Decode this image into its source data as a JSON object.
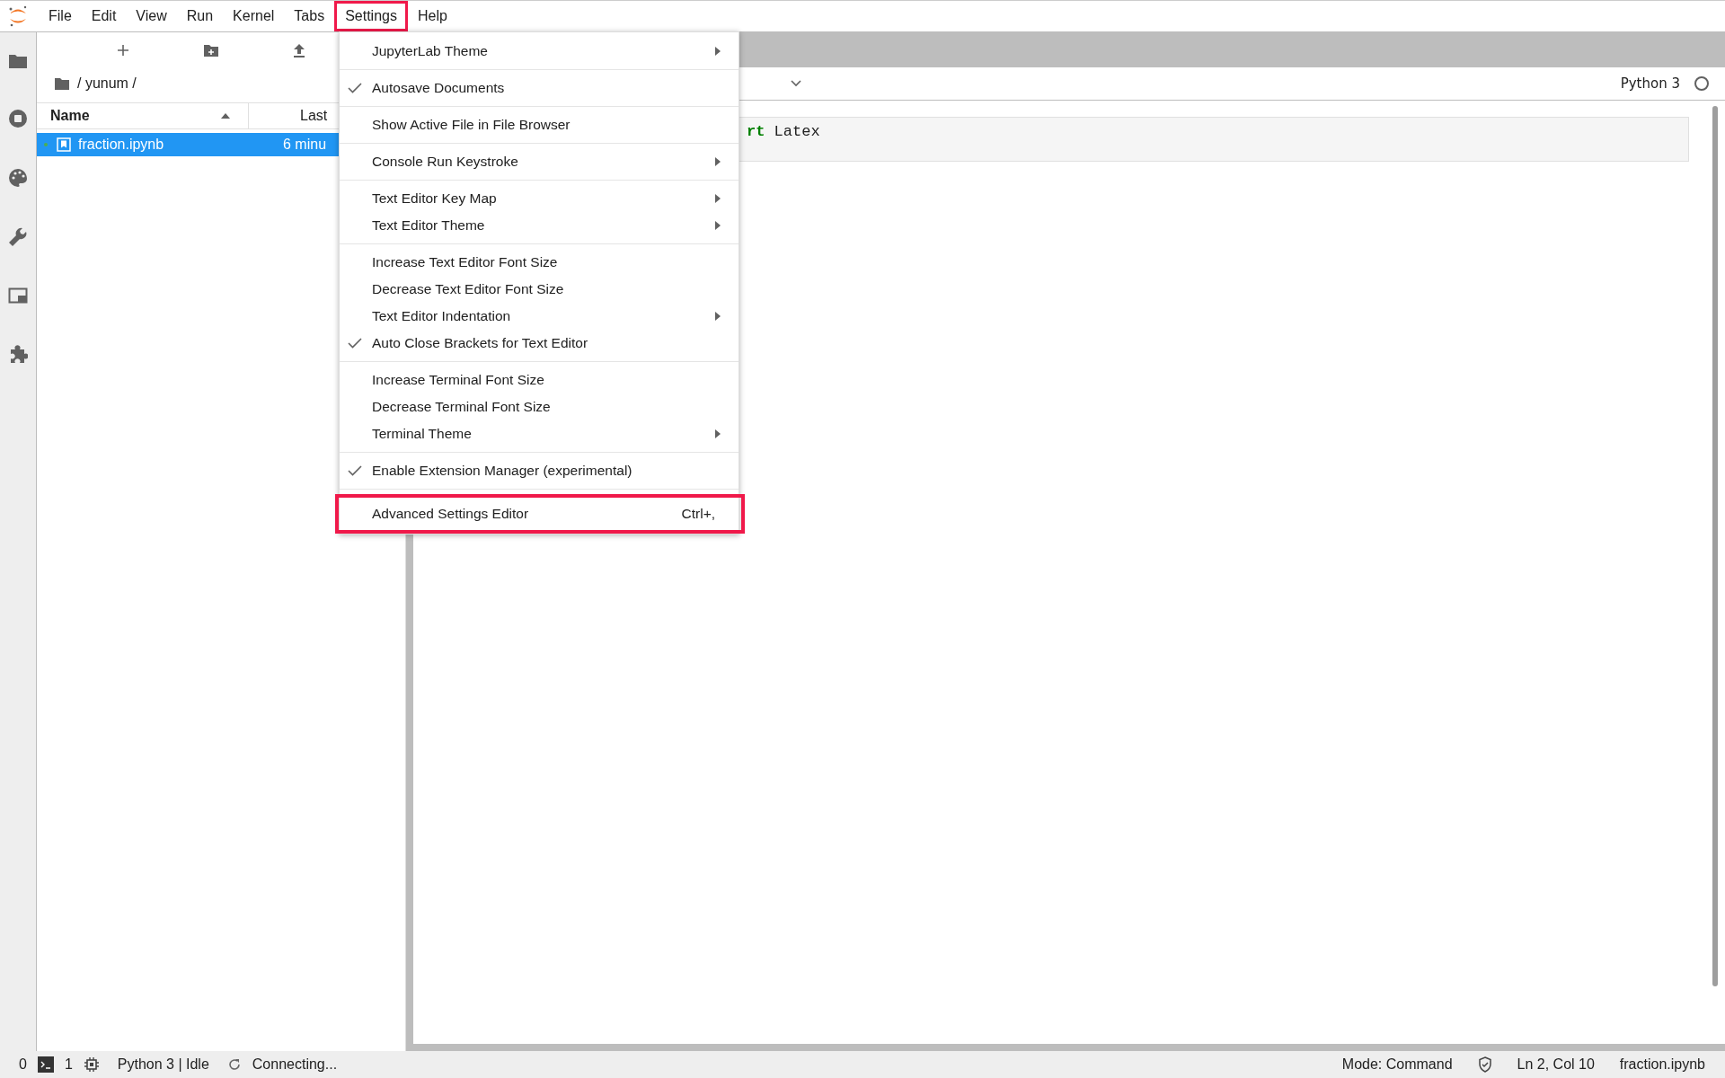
{
  "menu_bar": [
    {
      "label": "File",
      "selected": false
    },
    {
      "label": "Edit",
      "selected": false
    },
    {
      "label": "View",
      "selected": false
    },
    {
      "label": "Run",
      "selected": false
    },
    {
      "label": "Kernel",
      "selected": false
    },
    {
      "label": "Tabs",
      "selected": false
    },
    {
      "label": "Settings",
      "selected": true
    },
    {
      "label": "Help",
      "selected": false
    }
  ],
  "file_browser": {
    "breadcrumb": "/ yunum /",
    "columns": [
      "Name",
      "Last"
    ],
    "rows": [
      {
        "name": "fraction.ipynb",
        "modified": "6 minu",
        "selected": true,
        "running": true
      }
    ]
  },
  "notebook": {
    "kernel": "Python 3",
    "kernel_busy": false,
    "cell_code": [
      {
        "text": "rt",
        "kind": "keyword"
      },
      {
        "text": " Latex",
        "kind": "plain"
      }
    ]
  },
  "settings_menu": {
    "groups": [
      [
        {
          "label": "JupyterLab Theme",
          "checked": false,
          "submenu": true,
          "highlighted": false
        }
      ],
      [
        {
          "label": "Autosave Documents",
          "checked": true,
          "submenu": false,
          "highlighted": false
        }
      ],
      [
        {
          "label": "Show Active File in File Browser",
          "checked": false,
          "submenu": false,
          "highlighted": false
        }
      ],
      [
        {
          "label": "Console Run Keystroke",
          "checked": false,
          "submenu": true,
          "highlighted": false
        }
      ],
      [
        {
          "label": "Text Editor Key Map",
          "checked": false,
          "submenu": true,
          "highlighted": false
        },
        {
          "label": "Text Editor Theme",
          "checked": false,
          "submenu": true,
          "highlighted": false
        }
      ],
      [
        {
          "label": "Increase Text Editor Font Size",
          "checked": false,
          "submenu": false,
          "highlighted": false
        },
        {
          "label": "Decrease Text Editor Font Size",
          "checked": false,
          "submenu": false,
          "highlighted": false
        },
        {
          "label": "Text Editor Indentation",
          "checked": false,
          "submenu": true,
          "highlighted": false
        },
        {
          "label": "Auto Close Brackets for Text Editor",
          "checked": true,
          "submenu": false,
          "highlighted": false
        }
      ],
      [
        {
          "label": "Increase Terminal Font Size",
          "checked": false,
          "submenu": false,
          "highlighted": false
        },
        {
          "label": "Decrease Terminal Font Size",
          "checked": false,
          "submenu": false,
          "highlighted": false
        },
        {
          "label": "Terminal Theme",
          "checked": false,
          "submenu": true,
          "highlighted": false
        }
      ],
      [
        {
          "label": "Enable Extension Manager (experimental)",
          "checked": true,
          "submenu": false,
          "highlighted": false
        }
      ],
      [
        {
          "label": "Advanced Settings Editor",
          "checked": false,
          "submenu": false,
          "highlighted": true,
          "shortcut": "Ctrl+,"
        }
      ]
    ]
  },
  "status_bar": {
    "terminals": "0",
    "kernels": "1",
    "kernel_status": "Python 3 | Idle",
    "connection": "Connecting...",
    "mode": "Mode: Command",
    "position": "Ln 2, Col 10",
    "file": "fraction.ipynb"
  }
}
